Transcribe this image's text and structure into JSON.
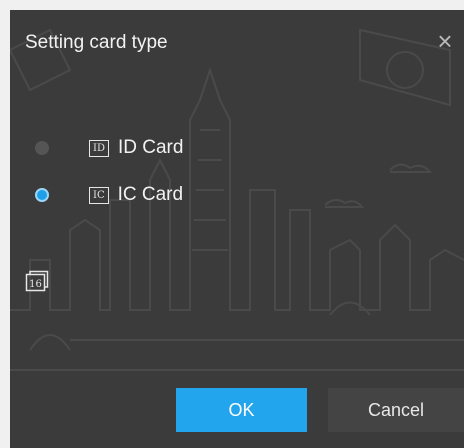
{
  "dialog": {
    "title": "Setting card type",
    "close_icon": "close-icon",
    "options": [
      {
        "tag": "ID",
        "label": "ID Card",
        "selected": false
      },
      {
        "tag": "IC",
        "label": "IC Card",
        "selected": true
      }
    ],
    "card_icon_text": "16",
    "ok_label": "OK",
    "cancel_label": "Cancel",
    "accent_color": "#22a5ed"
  }
}
